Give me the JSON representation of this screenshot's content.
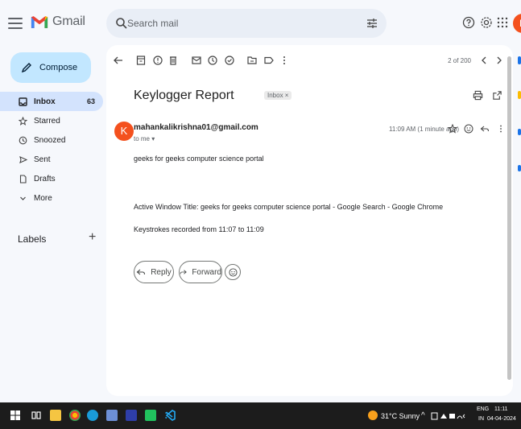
{
  "app": {
    "name": "Gmail"
  },
  "search": {
    "placeholder": "Search mail"
  },
  "compose": {
    "label": "Compose"
  },
  "sidebar": {
    "items": [
      {
        "label": "Inbox",
        "count": "63"
      },
      {
        "label": "Starred"
      },
      {
        "label": "Snoozed"
      },
      {
        "label": "Sent"
      },
      {
        "label": "Drafts"
      },
      {
        "label": "More"
      }
    ],
    "labels_heading": "Labels",
    "labels_add": "+"
  },
  "toolbar": {
    "paging": "2 of 200"
  },
  "email": {
    "subject": "Keylogger Report",
    "badge": "Inbox ×",
    "avatar_letter": "K",
    "sender": "mahankalikrishna01@gmail.com",
    "to": "to me ▾",
    "time": "11:09 AM (1 minute ago)",
    "body": [
      "geeks for geeks computer science portal",
      "Active Window Title: geeks for geeks computer science portal - Google Search - Google Chrome",
      "Keystrokes recorded from 11:07 to 11:09"
    ],
    "reply_label": "Reply",
    "forward_label": "Forward"
  },
  "taskbar": {
    "weather": "31°C  Sunny",
    "lang_top": "ENG",
    "lang_bottom": "IN",
    "time": "11:11",
    "date": "04-04-2024"
  },
  "colors": {
    "background": "#f6f8fc",
    "compose": "#c2e7ff",
    "active_nav": "#d3e3fd",
    "avatar": "#f4511e",
    "taskbar": "#1c1c1c"
  }
}
